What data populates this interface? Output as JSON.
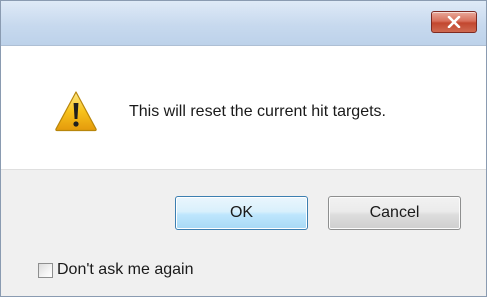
{
  "dialog": {
    "message": "This will reset the current hit targets.",
    "icon": "warning-icon"
  },
  "buttons": {
    "ok_label": "OK",
    "cancel_label": "Cancel",
    "close_icon": "close-icon"
  },
  "options": {
    "dont_ask_label": "Don't ask me again",
    "dont_ask_checked": false
  },
  "colors": {
    "titlebar": "#c7d9ee",
    "close_button": "#c2472f",
    "ok_border": "#3c7fb1",
    "warning_yellow": "#f7c21b"
  }
}
